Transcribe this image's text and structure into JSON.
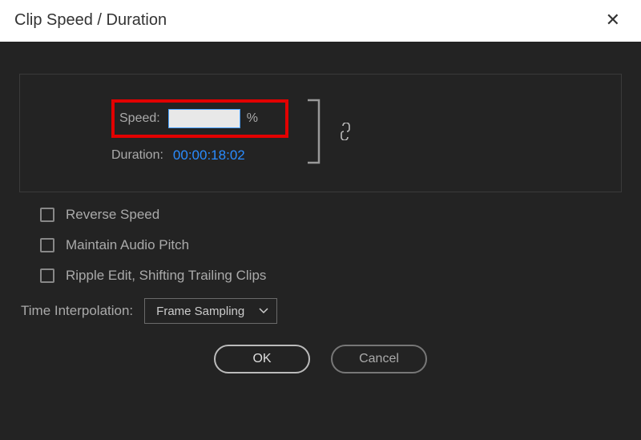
{
  "title": "Clip Speed / Duration",
  "speed": {
    "label": "Speed:",
    "value": "",
    "unit": "%"
  },
  "duration": {
    "label": "Duration:",
    "value": "00:00:18:02"
  },
  "checkboxes": {
    "reverse": "Reverse Speed",
    "pitch": "Maintain Audio Pitch",
    "ripple": "Ripple Edit, Shifting Trailing Clips"
  },
  "timeInterpolation": {
    "label": "Time Interpolation:",
    "selected": "Frame Sampling"
  },
  "buttons": {
    "ok": "OK",
    "cancel": "Cancel"
  }
}
